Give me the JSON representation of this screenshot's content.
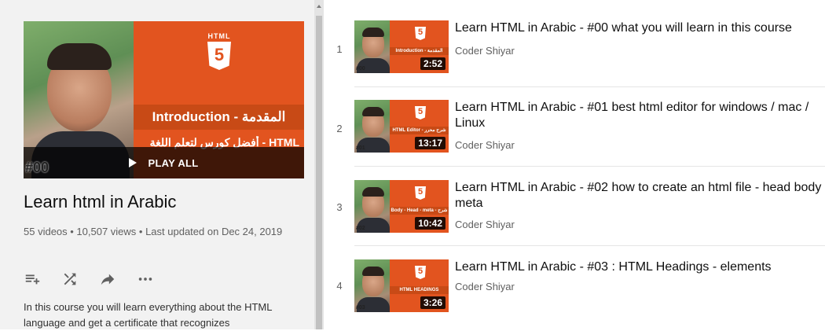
{
  "playlist": {
    "hero": {
      "band_text": "Introduction - المقدمة",
      "arabic_caption": "أفضل كورس لتعلم اللغة - HTML",
      "number": "#00",
      "play_all_label": "PLAY ALL"
    },
    "title": "Learn html in Arabic",
    "stats": "55 videos • 10,507 views • Last updated on Dec 24, 2019",
    "actions": [
      "add-to-queue",
      "shuffle",
      "share",
      "more"
    ],
    "description": "In this course you will learn everything about the HTML language and get a certificate that recognizes"
  },
  "videos": [
    {
      "index": "1",
      "title": "Learn HTML in Arabic - #00 what you will learn in this course",
      "channel": "Coder Shiyar",
      "duration": "2:52",
      "band": "Introduction - المقدمة",
      "num": "#00"
    },
    {
      "index": "2",
      "title": "Learn HTML in Arabic - #01 best html editor for windows / mac / Linux",
      "channel": "Coder Shiyar",
      "duration": "13:17",
      "band": "HTML Editor - شرح محرر",
      "num": "#01"
    },
    {
      "index": "3",
      "title": "Learn HTML in Arabic - #02 how to create an html file - head body meta",
      "channel": "Coder Shiyar",
      "duration": "10:42",
      "band": "Body - Head - meta - شرح",
      "num": "#02"
    },
    {
      "index": "4",
      "title": "Learn HTML in Arabic - #03 : HTML Headings - elements",
      "channel": "Coder Shiyar",
      "duration": "3:26",
      "band": "HTML HEADINGS",
      "num": "#03"
    }
  ],
  "colors": {
    "accent_orange": "#e2541f",
    "sidebar_bg": "#f2f2f2",
    "secondary_text": "#606060"
  }
}
